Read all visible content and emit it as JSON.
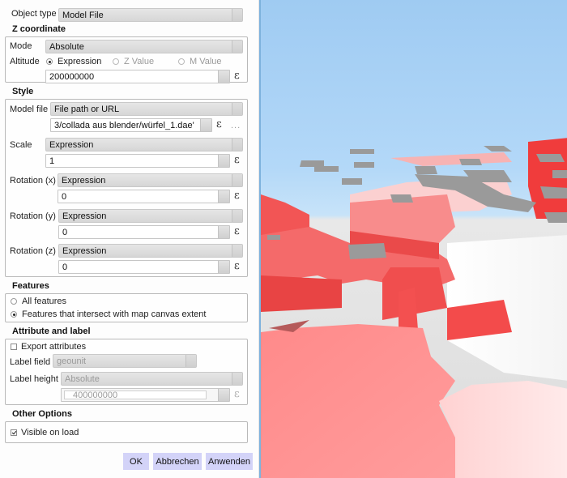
{
  "dialog": {
    "object_type": {
      "label": "Object type",
      "value": "Model File"
    },
    "z_coordinate": {
      "title": "Z coordinate",
      "mode": {
        "label": "Mode",
        "value": "Absolute"
      },
      "altitude": {
        "label": "Altitude",
        "options": [
          {
            "label": "Expression",
            "checked": true,
            "enabled": true
          },
          {
            "label": "Z Value",
            "checked": false,
            "enabled": false
          },
          {
            "label": "M Value",
            "checked": false,
            "enabled": false
          }
        ],
        "value": "200000000"
      }
    },
    "style": {
      "title": "Style",
      "model_file": {
        "label": "Model file",
        "source": "File path or URL",
        "value": "3/collada aus blender/würfel_1.dae'"
      },
      "scale": {
        "label": "Scale",
        "mode": "Expression",
        "value": "1"
      },
      "rotation_x": {
        "label": "Rotation (x)",
        "mode": "Expression",
        "value": "0"
      },
      "rotation_y": {
        "label": "Rotation (y)",
        "mode": "Expression",
        "value": "0"
      },
      "rotation_z": {
        "label": "Rotation (z)",
        "mode": "Expression",
        "value": "0"
      }
    },
    "features": {
      "title": "Features",
      "options": [
        {
          "label": "All features",
          "checked": false
        },
        {
          "label": "Features that intersect with map canvas extent",
          "checked": true
        }
      ]
    },
    "attribute_label": {
      "title": "Attribute and label",
      "export_attributes": {
        "label": "Export attributes",
        "checked": false
      },
      "label_field": {
        "label": "Label field",
        "value": "geounit"
      },
      "label_height": {
        "label": "Label height",
        "mode": "Absolute",
        "value": "400000000"
      }
    },
    "other_options": {
      "title": "Other Options",
      "visible_on_load": {
        "label": "Visible on load",
        "checked": true
      }
    },
    "expression_symbol": "ε",
    "browse_symbol": "...",
    "buttons": {
      "ok": "OK",
      "cancel": "Abbrechen",
      "apply": "Anwenden"
    }
  },
  "viewport": {
    "sky_color": "#a8d1f5",
    "ground_color": "#e0e0e0",
    "extrusion_color": "#f24a4a",
    "model_color": "#9a9a9a"
  }
}
